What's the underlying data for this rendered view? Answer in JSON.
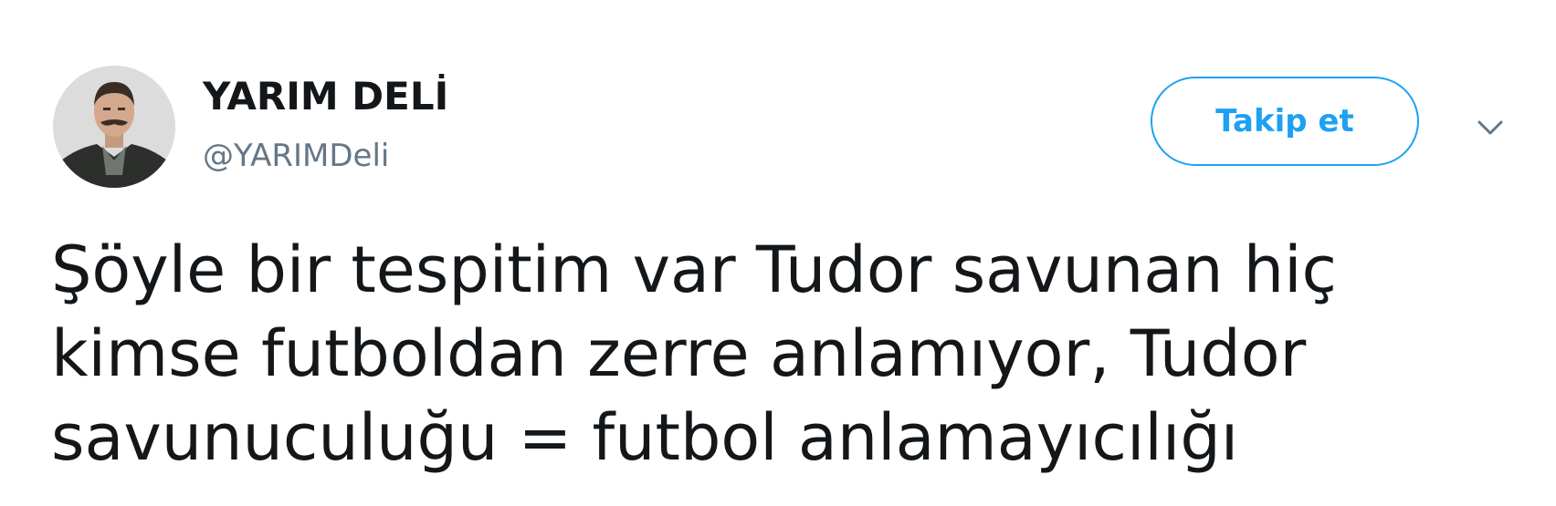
{
  "user": {
    "display_name": "YARIM DELİ",
    "handle": "@YARIMDeli",
    "avatar": "profile-photo"
  },
  "actions": {
    "follow_label": "Takip et",
    "menu_icon": "chevron-down-icon"
  },
  "tweet": {
    "lines": [
      "Şöyle bir tespitim var Tudor savunan hiç",
      "kimse futboldan zerre anlamıyor, Tudor",
      "savunuculuğu = futbol anlamayıcılığı"
    ]
  },
  "colors": {
    "accent": "#1da1f2",
    "text": "#14171a",
    "secondary_text": "#657786"
  }
}
